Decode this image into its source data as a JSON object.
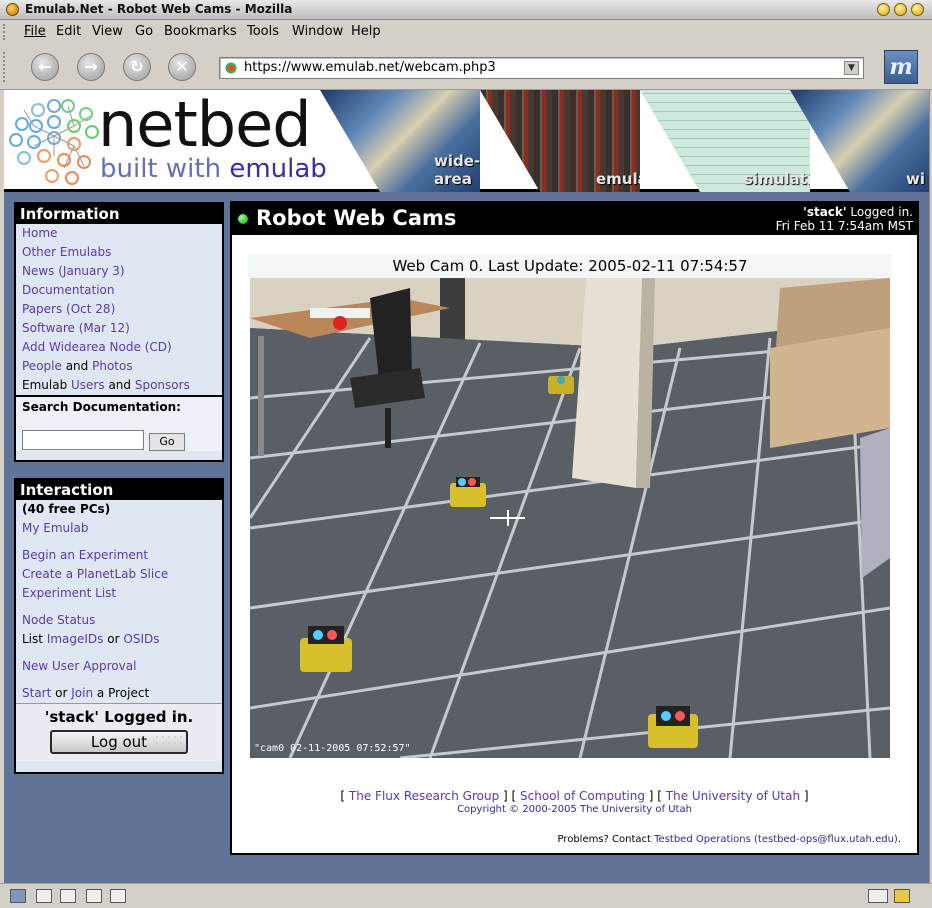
{
  "window": {
    "title": "Emulab.Net - Robot Web Cams - Mozilla"
  },
  "menubar": {
    "items": [
      "File",
      "Edit",
      "View",
      "Go",
      "Bookmarks",
      "Tools",
      "Window",
      "Help"
    ]
  },
  "navigation": {
    "url": "https://www.emulab.net/webcam.php3"
  },
  "banner": {
    "logo_main": "netbed",
    "logo_sub_prefix": "built with ",
    "logo_sub_brand": "emulab",
    "stripes": [
      "wide-area",
      "emulation",
      "simulation",
      "wi"
    ]
  },
  "sidebar": {
    "information": {
      "heading": "Information",
      "links": [
        "Home",
        "Other Emulabs",
        "News (January 3)",
        "Documentation",
        "Papers (Oct 28)",
        "Software (Mar 12)",
        "Add Widearea Node (CD)"
      ],
      "people": "People",
      "and": "and",
      "photos": "Photos",
      "emulab": "Emulab",
      "users": "Users",
      "sponsors": "Sponsors"
    },
    "search": {
      "label": "Search Documentation:",
      "value": "",
      "button": "Go"
    },
    "interaction": {
      "heading": "Interaction",
      "free_pcs": "(40 free PCs)",
      "my_emulab": "My Emulab",
      "begin_experiment": "Begin an Experiment",
      "create_slice": "Create a PlanetLab Slice",
      "experiment_list": "Experiment List",
      "node_status": "Node Status",
      "list": "List",
      "imageids": "ImageIDs",
      "or": "or",
      "osids": "OSIDs",
      "new_user_approval": "New User Approval",
      "start": "Start",
      "join": "Join",
      "a_project": "a Project"
    },
    "logged_in": "'stack' Logged in.",
    "logout": "Log out"
  },
  "main": {
    "title": "Robot Web Cams",
    "user": "'stack'",
    "logged_suffix": " Logged in.",
    "datetime": "Fri Feb 11 7:54am MST",
    "cam_caption": "Web Cam 0. Last Update: 2005-02-11 07:54:57",
    "cam_stamp": "\"cam0 02-11-2005 07:52:57\"",
    "footer": {
      "flux": "The Flux Research Group",
      "soc": "School of Computing",
      "uofu": "The University of Utah",
      "copyright": "Copyright © 2000-2005 The University of Utah",
      "problems_prefix": "Problems? Contact",
      "problems_link": "Testbed Operations (testbed-ops@flux.utah.edu)",
      "problems_suffix": "."
    }
  }
}
